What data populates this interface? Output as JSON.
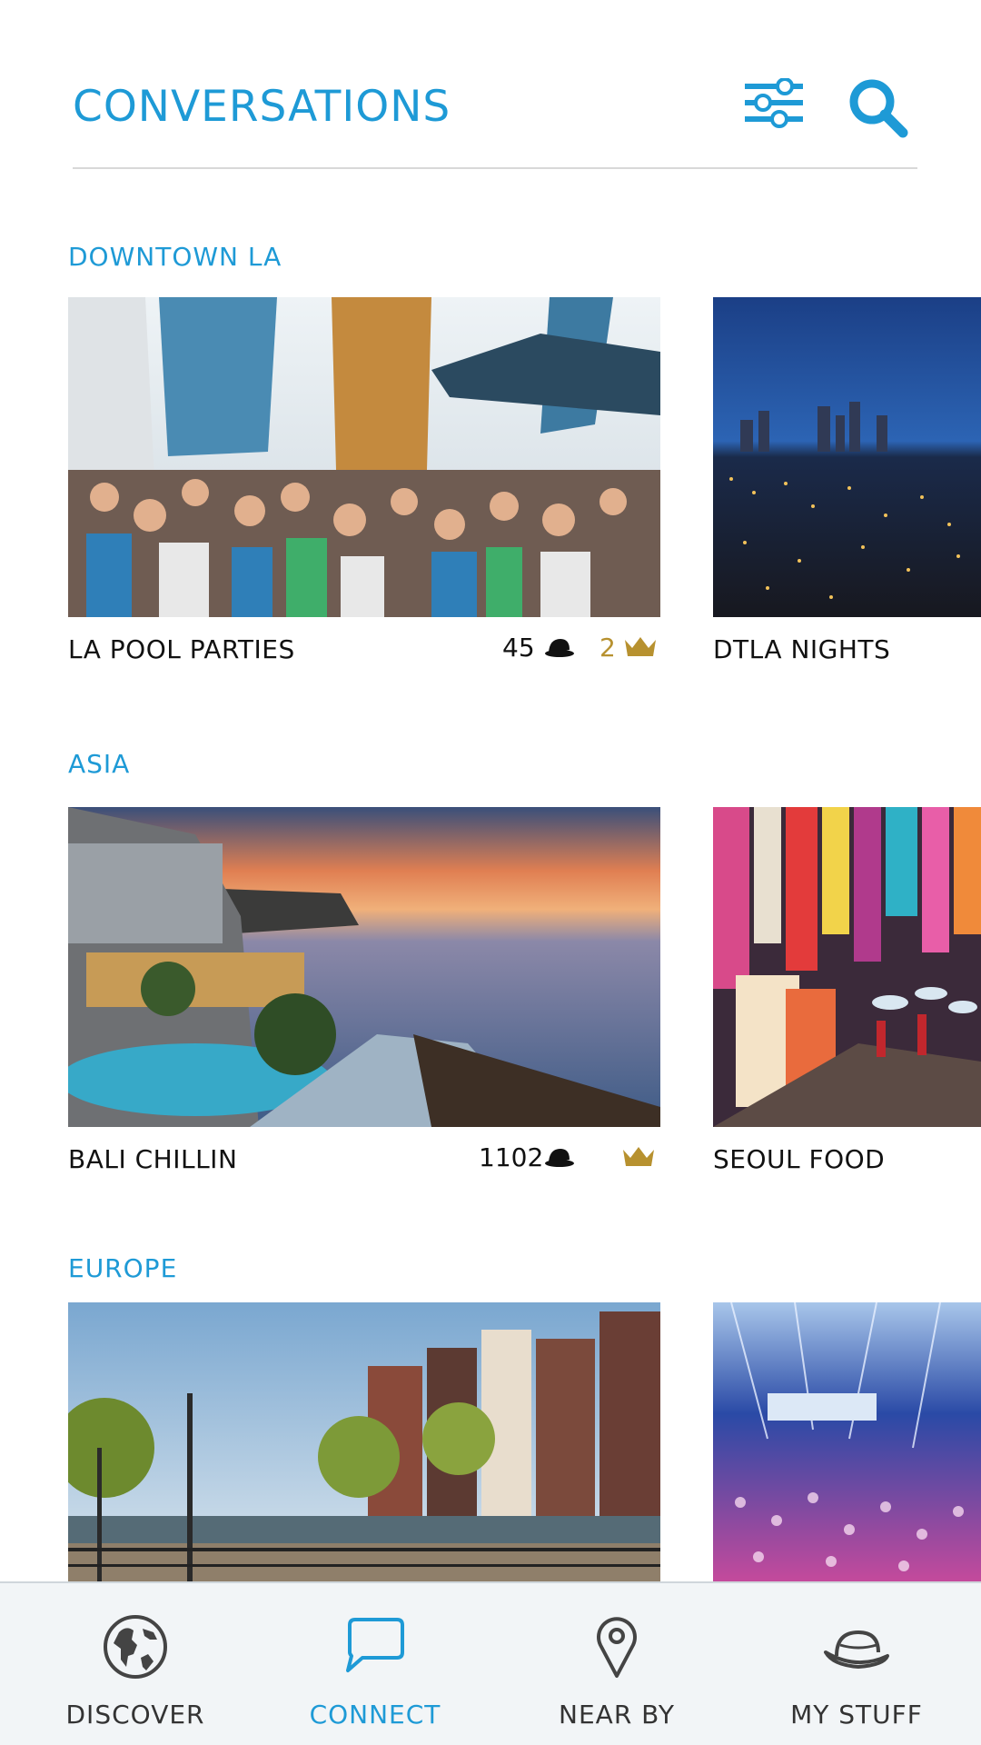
{
  "header": {
    "title": "CONVERSATIONS"
  },
  "sections": [
    {
      "title": "DOWNTOWN LA",
      "cards": [
        {
          "name": "LA POOL PARTIES",
          "hats": "45",
          "crowns": "2",
          "image": "rooftop pool party crowd"
        },
        {
          "name": "DTLA NIGHTS",
          "image": "night city skyline"
        }
      ]
    },
    {
      "title": "ASIA",
      "cards": [
        {
          "name": "BALI CHILLIN",
          "hats": "1102",
          "crowns": "",
          "image": "cliffside resort at sunset"
        },
        {
          "name": "SEOUL FOOD",
          "image": "neon street market"
        }
      ]
    },
    {
      "title": "EUROPE",
      "cards": [
        {
          "name": "",
          "image": "canal houses"
        },
        {
          "name": "",
          "image": "concert crowd"
        }
      ]
    }
  ],
  "nav": {
    "items": [
      {
        "label": "DISCOVER",
        "icon": "globe-icon"
      },
      {
        "label": "CONNECT",
        "icon": "chat-bubble-icon",
        "active": true
      },
      {
        "label": "NEAR BY",
        "icon": "location-pin-icon"
      },
      {
        "label": "MY STUFF",
        "icon": "hat-icon"
      }
    ]
  },
  "colors": {
    "accent": "#1e9ad6",
    "gold": "#b7912f",
    "nav_bg": "#f2f5f7"
  }
}
